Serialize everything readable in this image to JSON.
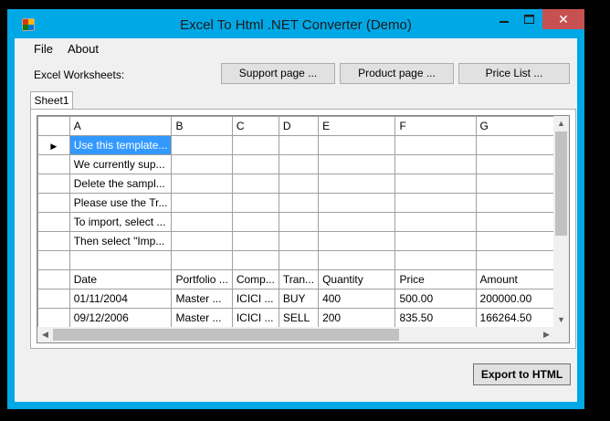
{
  "window": {
    "title": "Excel To Html .NET Converter (Demo)",
    "close_glyph": "✕"
  },
  "menu": {
    "file": "File",
    "about": "About"
  },
  "worksheets_label": "Excel Worksheets:",
  "buttons": {
    "support": "Support page ...",
    "product": "Product page ...",
    "price": "Price List ..."
  },
  "tab": "Sheet1",
  "grid": {
    "columns": [
      "A",
      "B",
      "C",
      "D",
      "E",
      "F",
      "G"
    ],
    "rows": [
      [
        "Use this template...",
        "",
        "",
        "",
        "",
        "",
        ""
      ],
      [
        "We currently sup...",
        "",
        "",
        "",
        "",
        "",
        ""
      ],
      [
        "Delete the sampl...",
        "",
        "",
        "",
        "",
        "",
        ""
      ],
      [
        "Please use the Tr...",
        "",
        "",
        "",
        "",
        "",
        ""
      ],
      [
        "To import, select ...",
        "",
        "",
        "",
        "",
        "",
        ""
      ],
      [
        "Then select \"Imp...",
        "",
        "",
        "",
        "",
        "",
        ""
      ],
      [
        "",
        "",
        "",
        "",
        "",
        "",
        ""
      ],
      [
        "Date",
        "Portfolio ...",
        "Comp...",
        "Tran...",
        "Quantity",
        "Price",
        "Amount"
      ],
      [
        "01/11/2004",
        "Master ...",
        "ICICI ...",
        "BUY",
        "400",
        "500.00",
        "200000.00"
      ],
      [
        "09/12/2006",
        "Master ...",
        "ICICI ...",
        "SELL",
        "200",
        "835.50",
        "166264.50"
      ]
    ],
    "current_row_marker": "▶",
    "selected_cell": {
      "row": 0,
      "col": 0
    }
  },
  "export_button": "Export to HTML",
  "colors": {
    "titlebar": "#00a8e6",
    "selection": "#3399ff",
    "close": "#c75050"
  }
}
